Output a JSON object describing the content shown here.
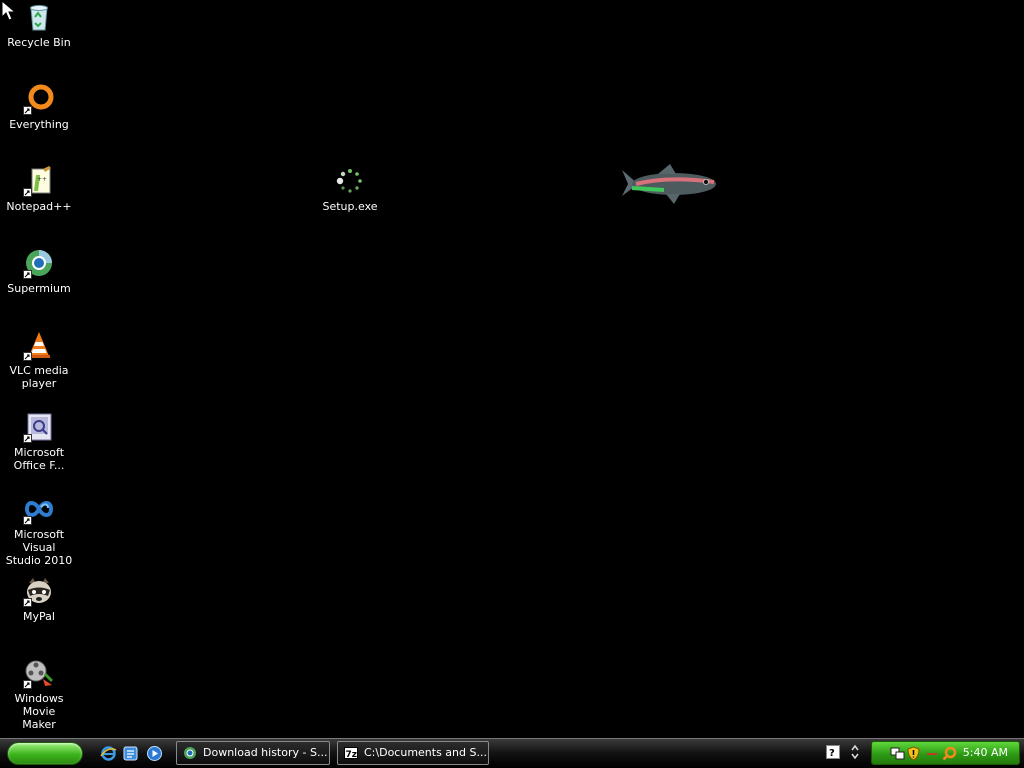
{
  "desktop": {
    "icons": [
      {
        "label": "Recycle Bin",
        "icon": "recycle-bin-icon"
      },
      {
        "label": "Everything",
        "icon": "everything-search-icon"
      },
      {
        "label": "Notepad++",
        "icon": "notepad-plus-plus-icon"
      },
      {
        "label": "Supermium",
        "icon": "supermium-browser-icon"
      },
      {
        "label": "VLC media\nplayer",
        "icon": "vlc-cone-icon"
      },
      {
        "label": "Microsoft\nOffice F...",
        "icon": "office-document-icon"
      },
      {
        "label": "Microsoft Visual\nStudio 2010",
        "icon": "visual-studio-icon"
      },
      {
        "label": "MyPal",
        "icon": "mypal-raccoon-icon"
      },
      {
        "label": "Windows Movie\nMaker",
        "icon": "movie-maker-film-icon"
      },
      {
        "label": "Setup.exe",
        "icon": "loading-spinner-icon"
      }
    ]
  },
  "taskbar": {
    "quick_launch": [
      "internet-explorer-icon",
      "desktop-switch-icon",
      "media-player-icon"
    ],
    "buttons": [
      {
        "label": "Download history - S...",
        "icon": "supermium-browser-icon"
      },
      {
        "label": "C:\\Documents and S...",
        "icon": "7zip-icon"
      }
    ],
    "tray": {
      "icons": [
        "network-icon",
        "security-shield-icon",
        "arrow-icon",
        "search-icon"
      ],
      "clock": "5:40 AM"
    }
  },
  "colors": {
    "desktop_bg": "#000000",
    "taskbar_bg": "#111111",
    "tray_green": "#2e9b15",
    "start_green": "#3cb41c"
  }
}
